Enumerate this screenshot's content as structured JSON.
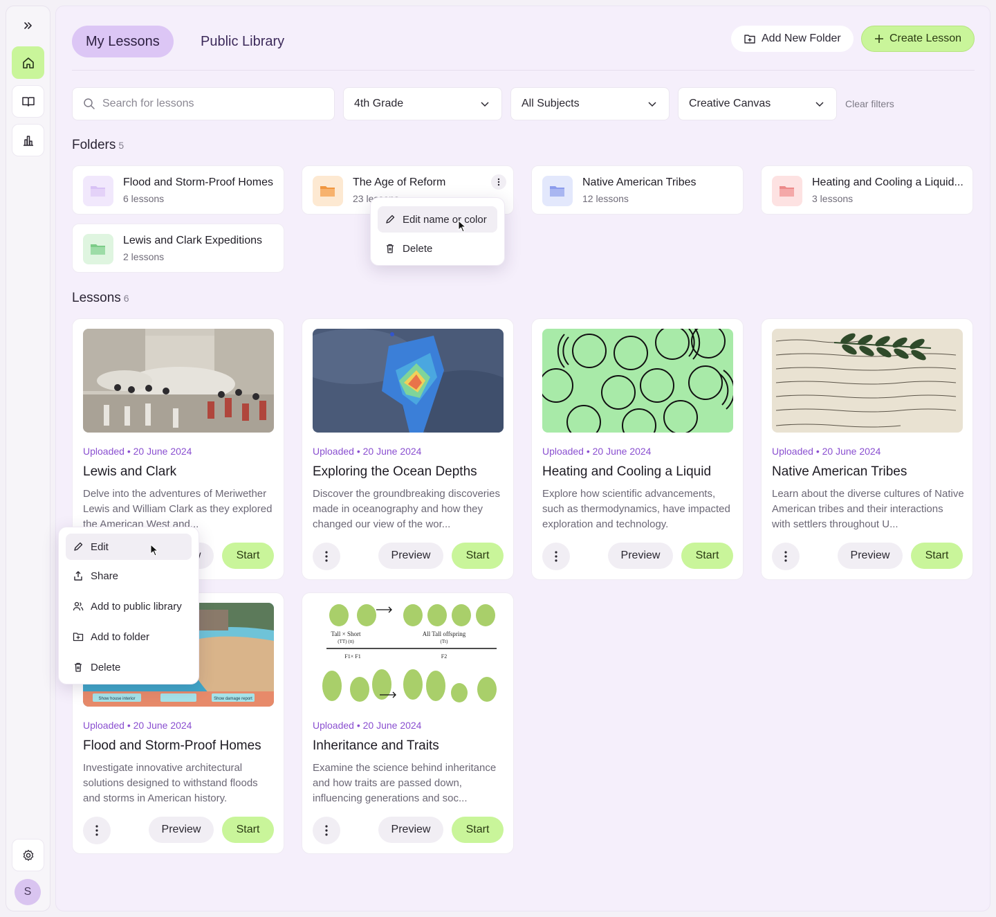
{
  "sidebar": {
    "avatar_initial": "S",
    "icons": [
      "expand-icon",
      "home-icon",
      "book-icon",
      "chart-icon",
      "gear-icon"
    ]
  },
  "header": {
    "tabs": [
      {
        "label": "My Lessons",
        "active": true
      },
      {
        "label": "Public Library",
        "active": false
      }
    ],
    "add_folder_label": "Add New Folder",
    "create_lesson_label": "Create Lesson"
  },
  "filters": {
    "search_placeholder": "Search for lessons",
    "grade": "4th Grade",
    "subject": "All Subjects",
    "tool": "Creative Canvas",
    "clear_label": "Clear filters"
  },
  "folders_section": {
    "title": "Folders",
    "count": "5",
    "items": [
      {
        "name": "Flood and Storm-Proof Homes",
        "sub": "6 lessons",
        "color": "#ede1fb",
        "icon_color": "#d8c2f5"
      },
      {
        "name": "The Age of Reform",
        "sub": "23 lessons",
        "color": "#fde8d0",
        "icon_color": "#f5a95b"
      },
      {
        "name": "Native American Tribes",
        "sub": "12 lessons",
        "color": "#e1e6fb",
        "icon_color": "#9aa9ee"
      },
      {
        "name": "Heating and Cooling a Liquid...",
        "sub": "3 lessons",
        "color": "#fde0e0",
        "icon_color": "#f29a9a"
      },
      {
        "name": "Lewis and Clark Expeditions",
        "sub": "2 lessons",
        "color": "#def5df",
        "icon_color": "#8fd69a"
      }
    ]
  },
  "folder_menu": {
    "edit_label": "Edit name or color",
    "delete_label": "Delete"
  },
  "lessons_section": {
    "title": "Lessons",
    "count": "6",
    "items": [
      {
        "uploaded": "Uploaded • 20 June 2024",
        "title": "Lewis and Clark",
        "desc": "Delve into the adventures of Meriwether Lewis and William Clark as they explored the American West and..."
      },
      {
        "uploaded": "Uploaded • 20 June 2024",
        "title": "Exploring the Ocean Depths",
        "desc": "Discover the groundbreaking discoveries made in oceanography and how they changed our view of the wor..."
      },
      {
        "uploaded": "Uploaded • 20 June 2024",
        "title": "Heating and Cooling a Liquid",
        "desc": "Explore how scientific advancements, such as thermodynamics, have impacted exploration and technology."
      },
      {
        "uploaded": "Uploaded • 20 June 2024",
        "title": "Native American Tribes",
        "desc": "Learn about the diverse cultures of Native American tribes and their interactions with settlers throughout U..."
      },
      {
        "uploaded": "Uploaded • 20 June 2024",
        "title": "Flood and Storm-Proof Homes",
        "desc": "Investigate innovative architectural solutions designed to withstand floods and storms in American history."
      },
      {
        "uploaded": "Uploaded • 20 June 2024",
        "title": "Inheritance and Traits",
        "desc": "Examine the science behind inheritance and how traits are passed down, influencing generations and soc..."
      }
    ],
    "preview_label": "Preview",
    "start_label": "Start"
  },
  "lesson_menu": {
    "items": [
      "Edit",
      "Share",
      "Add to public library",
      "Add to folder",
      "Delete"
    ]
  },
  "thumbnails": {
    "flood_buttons": [
      "Show house interior",
      "Show damage report"
    ],
    "genetics": {
      "cross_left": "Tall × Short",
      "cross_left_sub": "(TT)      (tt)",
      "offspring": "All Tall offspring",
      "offspring_sub": "(Tt)",
      "f1": "F1× F1",
      "f2": "F2"
    }
  }
}
